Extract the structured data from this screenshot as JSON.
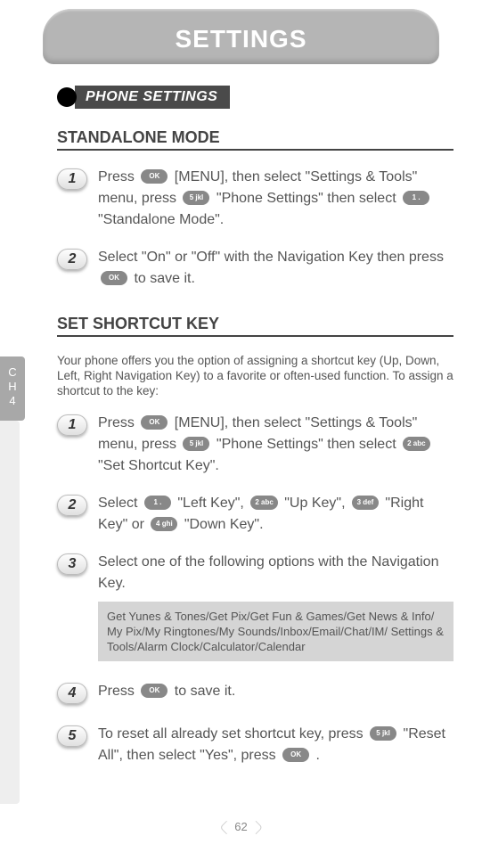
{
  "title": "SETTINGS",
  "section_header": "PHONE SETTINGS",
  "side_tab": {
    "line1": "C",
    "line2": "H",
    "line3": "4"
  },
  "standalone": {
    "title": "STANDALONE MODE",
    "steps": {
      "s1": {
        "num": "1",
        "t1": "Press ",
        "k1": "OK",
        "t2": " [MENU], then select \"Settings & Tools\" menu, press ",
        "k2": "5 jkl",
        "t3": " \"Phone Settings\" then select ",
        "k3": "1 .",
        "t4": " \"Standalone Mode\"."
      },
      "s2": {
        "num": "2",
        "t1": "Select \"On\" or \"Off\" with the Navigation Key then press ",
        "k1": "OK",
        "t2": " to save it."
      }
    }
  },
  "shortcut": {
    "title": "SET SHORTCUT KEY",
    "intro": "Your phone offers you the option of assigning a shortcut key (Up, Down, Left, Right Navigation Key) to a favorite or often-used function. To assign a shortcut to the key:",
    "steps": {
      "s1": {
        "num": "1",
        "t1": "Press ",
        "k1": "OK",
        "t2": " [MENU], then select \"Settings & Tools\" menu, press ",
        "k2": "5 jkl",
        "t3": " \"Phone Settings\" then select ",
        "k3": "2 abc",
        "t4": " \"Set Shortcut Key\"."
      },
      "s2": {
        "num": "2",
        "t1": "Select ",
        "k1": "1 .",
        "t2": " \"Left Key\", ",
        "k2": "2 abc",
        "t3": " \"Up Key\", ",
        "k3": "3 def",
        "t4": " \"Right Key\" or ",
        "k4": "4 ghi",
        "t5": " \"Down Key\"."
      },
      "s3": {
        "num": "3",
        "t1": "Select one of the following options with the Navigation Key.",
        "opts": "Get Yunes & Tones/Get Pix/Get Fun & Games/Get News & Info/ My Pix/My Ringtones/My Sounds/Inbox/Email/Chat/IM/ Settings & Tools/Alarm Clock/Calculator/Calendar"
      },
      "s4": {
        "num": "4",
        "t1": "Press ",
        "k1": "OK",
        "t2": " to save it."
      },
      "s5": {
        "num": "5",
        "t1": "To reset all already set shortcut key, press ",
        "k1": "5 jkl",
        "t2": " \"Reset All\", then select \"Yes\", press ",
        "k2": "OK",
        "t3": " ."
      }
    }
  },
  "page_number": "62"
}
